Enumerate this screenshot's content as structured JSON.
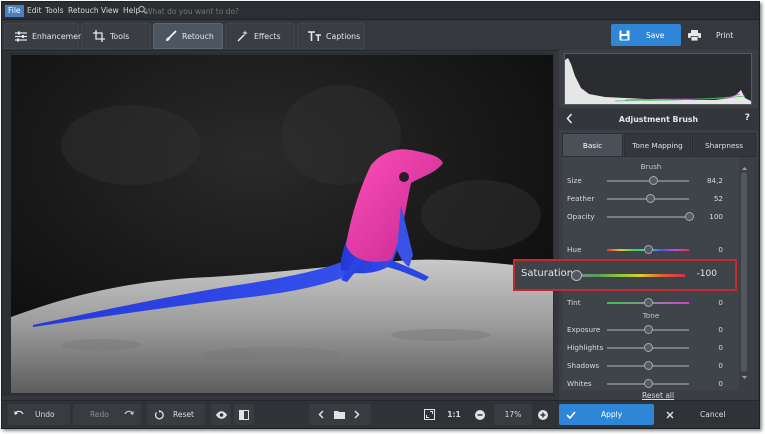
{
  "menu": {
    "items": [
      "File",
      "Edit",
      "Tools",
      "Retouch",
      "View",
      "Help"
    ],
    "search_placeholder": "What do you want to do?"
  },
  "toolbar": {
    "tabs": [
      "Enhancement",
      "Tools",
      "Retouch",
      "Effects",
      "Captions"
    ],
    "selected_tab": "Retouch",
    "save_label": "Save",
    "print_label": "Print"
  },
  "panel": {
    "title": "Adjustment Brush",
    "help": "?",
    "tabs": [
      "Basic",
      "Tone Mapping",
      "Sharpness"
    ],
    "selected_tab": "Basic",
    "brush_section": "Brush",
    "brush_rows": [
      {
        "label": "Size",
        "value": "84,2",
        "fraction": 0.56
      },
      {
        "label": "Feather",
        "value": "52",
        "fraction": 0.52
      },
      {
        "label": "Opacity",
        "value": "100",
        "fraction": 1.0
      }
    ],
    "hue": {
      "label": "Hue",
      "value": "0",
      "fraction": 0.5
    },
    "saturation": {
      "label": "Saturation",
      "value": "-100",
      "fraction": 0.0
    },
    "tint": {
      "label": "Tint",
      "value": "0",
      "fraction": 0.5
    },
    "tone_section": "Tone",
    "tone_rows": [
      {
        "label": "Exposure",
        "value": "0",
        "fraction": 0.5
      },
      {
        "label": "Highlights",
        "value": "0",
        "fraction": 0.5
      },
      {
        "label": "Shadows",
        "value": "0",
        "fraction": 0.5
      },
      {
        "label": "Whites",
        "value": "0",
        "fraction": 0.5
      }
    ],
    "reset_all": "Reset all"
  },
  "bottom": {
    "undo_label": "Undo",
    "redo_label": "Redo",
    "reset_label": "Reset",
    "zoom_ratio": "1:1",
    "zoom_level": "17%",
    "apply_label": "Apply",
    "cancel_label": "Cancel"
  },
  "colors": {
    "accent": "#2f86d6",
    "highlight_border": "#c8282d",
    "background": "#33373c"
  }
}
